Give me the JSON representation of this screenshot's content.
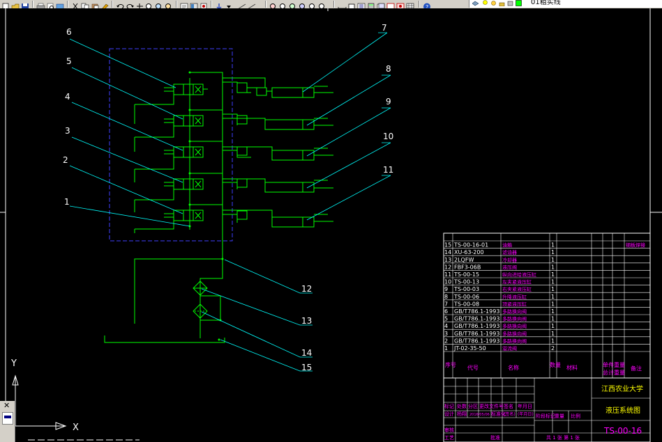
{
  "layer": {
    "name": "01粗实线"
  },
  "colors": {
    "line": "#00ff00",
    "text": "#ffffff",
    "leader": "#00ffff",
    "frame": "#4040ff",
    "table_text": "#ff00ff",
    "title_text": "#ffff00",
    "background": "#000000"
  },
  "callouts": [
    "1",
    "2",
    "3",
    "4",
    "5",
    "6",
    "7",
    "8",
    "9",
    "10",
    "11",
    "12",
    "13",
    "14",
    "15"
  ],
  "ucs": {
    "x_label": "X",
    "y_label": "Y"
  },
  "bom": {
    "header": {
      "seq": "序号",
      "code": "代号",
      "name": "名称",
      "qty": "数量",
      "material": "材料",
      "unit_weight": "单件重量",
      "total_weight": "总计重量",
      "remark": "备注"
    },
    "rows": [
      {
        "no": "15",
        "code": "TS-00-16-01",
        "name": "油箱",
        "qty": "1",
        "remark": "钢板焊接"
      },
      {
        "no": "14",
        "code": "XU-63-200",
        "name": "滤油器",
        "qty": "1",
        "remark": ""
      },
      {
        "no": "13",
        "code": "2LQFW",
        "name": "冷却器",
        "qty": "1",
        "remark": ""
      },
      {
        "no": "12",
        "code": "FBF3-06B",
        "name": "液压阀",
        "qty": "1",
        "remark": ""
      },
      {
        "no": "11",
        "code": "TS-00-15",
        "name": "纵向进给液压缸",
        "qty": "1",
        "remark": ""
      },
      {
        "no": "10",
        "code": "TS-00-13",
        "name": "左夹紧液压缸",
        "qty": "1",
        "remark": ""
      },
      {
        "no": "9",
        "code": "TS-00-03",
        "name": "右夹紧液压缸",
        "qty": "1",
        "remark": ""
      },
      {
        "no": "8",
        "code": "TS-00-06",
        "name": "升降液压缸",
        "qty": "1",
        "remark": ""
      },
      {
        "no": "7",
        "code": "TS-00-08",
        "name": "顶紧液压缸",
        "qty": "1",
        "remark": ""
      },
      {
        "no": "6",
        "code": "GB/T786.1-1993",
        "name": "多路换向阀",
        "qty": "1",
        "remark": ""
      },
      {
        "no": "5",
        "code": "GB/T786.1-1993",
        "name": "多路换向阀",
        "qty": "1",
        "remark": ""
      },
      {
        "no": "4",
        "code": "GB/T786.1-1993",
        "name": "多路换向阀",
        "qty": "1",
        "remark": ""
      },
      {
        "no": "3",
        "code": "GB/T786.1-1993",
        "name": "多路换向阀",
        "qty": "1",
        "remark": ""
      },
      {
        "no": "2",
        "code": "GB/T786.1-1993",
        "name": "多路换向阀",
        "qty": "1",
        "remark": ""
      },
      {
        "no": "1",
        "code": "JT-02-35-50",
        "name": "溢流阀",
        "qty": "2",
        "remark": ""
      }
    ]
  },
  "titleblock": {
    "school": "江西农业大学",
    "drawing_name": "液压系统图",
    "drawing_no": "TS-00-16",
    "row1": [
      "标记",
      "处数",
      "分区",
      "更改文件号",
      "签名",
      "年月日"
    ],
    "row2": [
      "设计",
      "杨翔",
      "2016/05/06",
      "标准化",
      "(签名)",
      "(年月日)"
    ],
    "stage_label": "阶段标记",
    "weight_label": "重量",
    "scale_label": "比例",
    "review": "审核",
    "process": "工艺",
    "approve": "批准",
    "sheets": "共 1 张 第 1 张"
  }
}
